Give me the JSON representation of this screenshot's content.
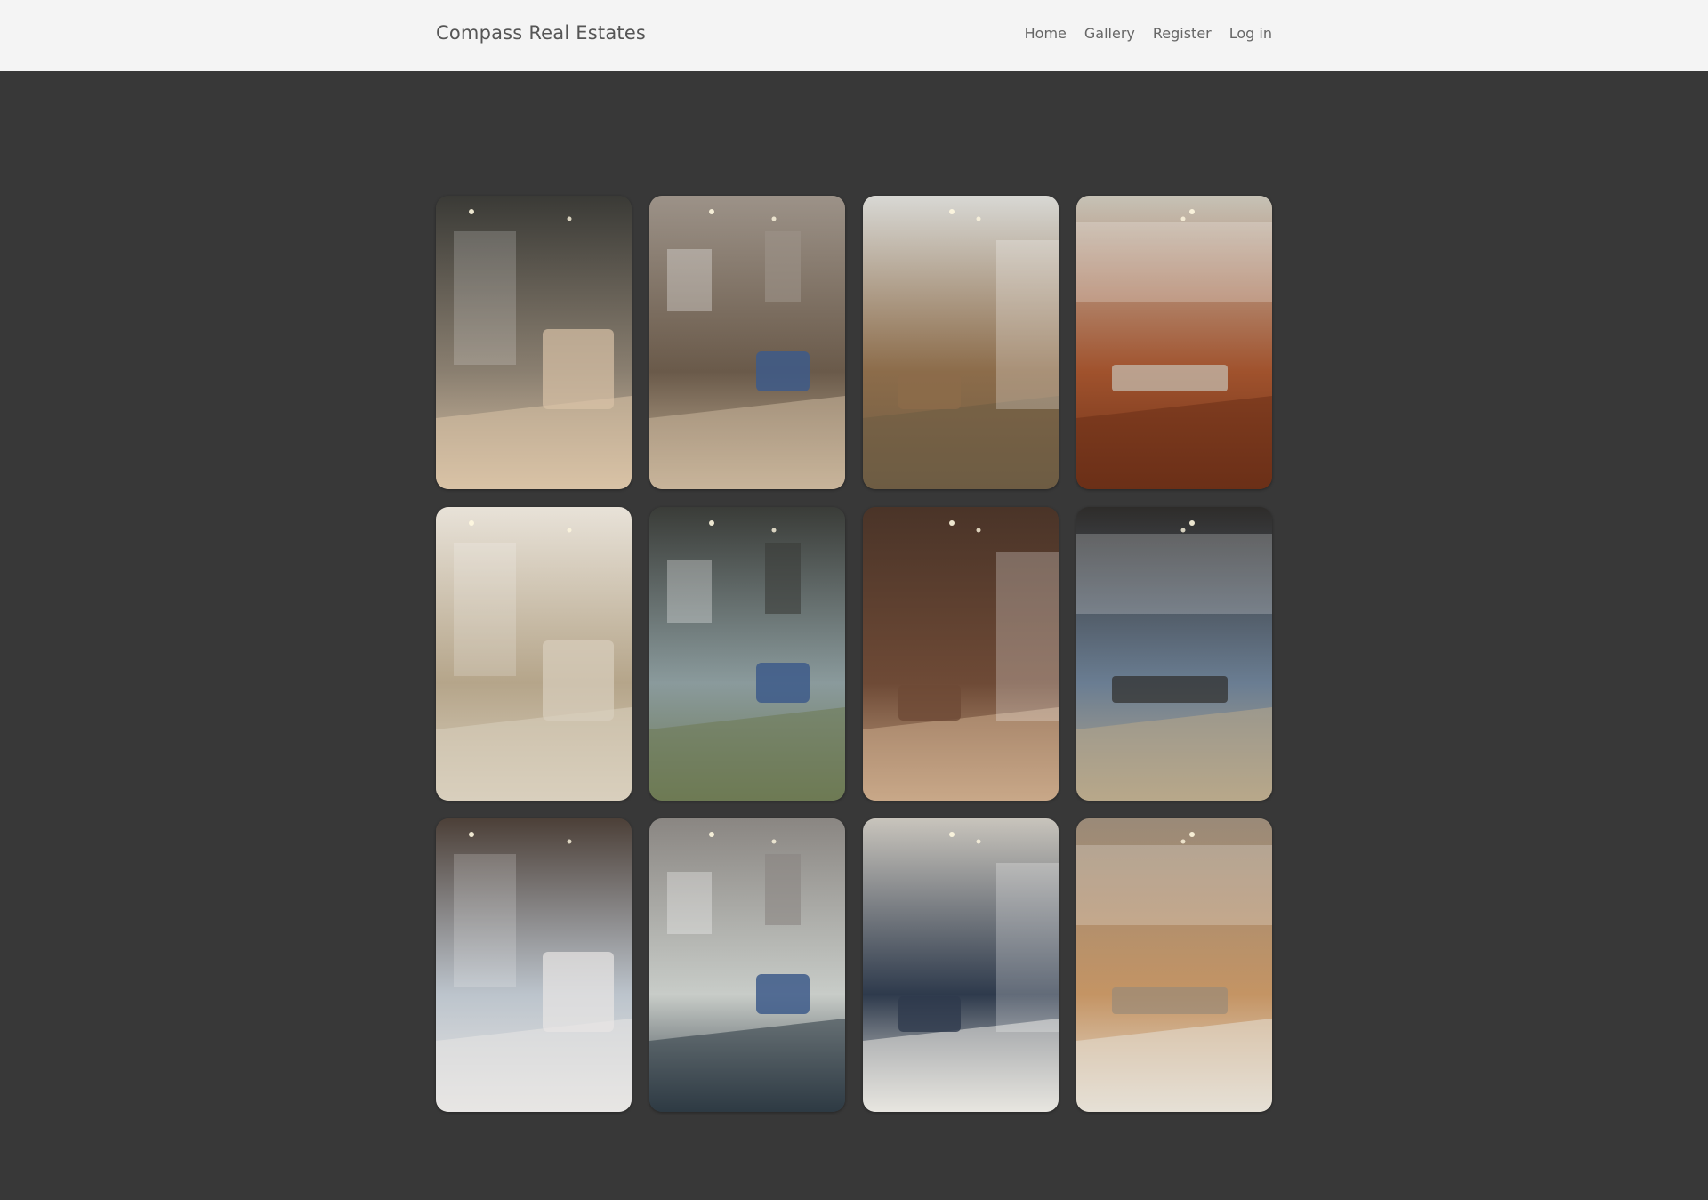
{
  "navbar": {
    "brand": "Compass Real Estates",
    "links": [
      "Home",
      "Gallery",
      "Register",
      "Log in"
    ]
  },
  "gallery": {
    "photos": [
      {
        "name": "bathroom-photo",
        "tones": [
          "#3a3a36",
          "#8a7f70",
          "#d9c2a6"
        ]
      },
      {
        "name": "kitchen-living-photo",
        "tones": [
          "#9c9288",
          "#6a5a4a",
          "#c8b59a"
        ]
      },
      {
        "name": "living-room-vaulted-photo",
        "tones": [
          "#d8d8d4",
          "#8c6c4a",
          "#6e5c44"
        ]
      },
      {
        "name": "dining-room-photo",
        "tones": [
          "#c6c2b6",
          "#a0522d",
          "#6b3018"
        ]
      },
      {
        "name": "bright-living-room-photo",
        "tones": [
          "#e8e2d8",
          "#b5a58a",
          "#d9cfbd"
        ]
      },
      {
        "name": "city-view-bathroom-photo",
        "tones": [
          "#3a3c38",
          "#8a9a9c",
          "#6e7a54"
        ]
      },
      {
        "name": "console-table-photo",
        "tones": [
          "#4a3428",
          "#6e4a36",
          "#c8a888"
        ]
      },
      {
        "name": "loft-living-room-photo",
        "tones": [
          "#2e2c2a",
          "#6a7d92",
          "#b8a88a"
        ]
      },
      {
        "name": "bedroom-city-view-photo",
        "tones": [
          "#4c4038",
          "#bcc4cc",
          "#e8e6e4"
        ]
      },
      {
        "name": "stone-wall-patio-photo",
        "tones": [
          "#8a8682",
          "#c8ccc8",
          "#2e3a44"
        ]
      },
      {
        "name": "dining-chandelier-photo",
        "tones": [
          "#c8c4bc",
          "#2e3a4c",
          "#e8e6e0"
        ]
      },
      {
        "name": "loft-bedroom-photo",
        "tones": [
          "#9a8a78",
          "#c49464",
          "#e6e0d6"
        ]
      }
    ]
  }
}
